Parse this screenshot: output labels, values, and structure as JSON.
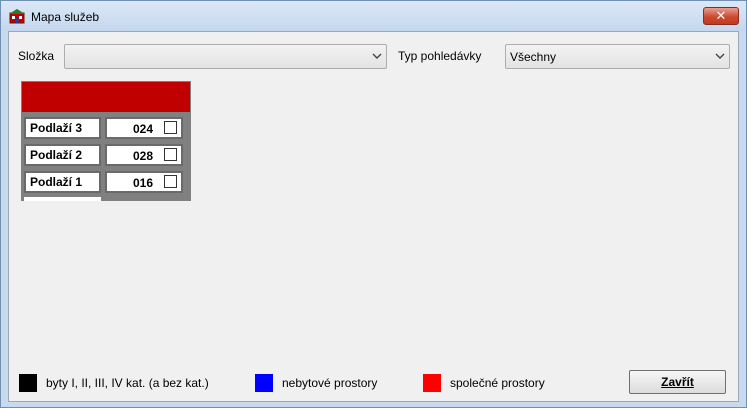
{
  "window": {
    "title": "Mapa služeb",
    "close_label": "✕"
  },
  "filters": {
    "folder_label": "Složka",
    "folder_value": "",
    "type_label": "Typ pohledávky",
    "type_value": "Všechny"
  },
  "map": {
    "header_color": "#c00000",
    "floors": [
      {
        "label": "Podlaží 3",
        "code": "024",
        "checked": false
      },
      {
        "label": "Podlaží 2",
        "code": "028",
        "checked": false
      },
      {
        "label": "Podlaží 1",
        "code": "016",
        "checked": false
      }
    ]
  },
  "legend": [
    {
      "label": "byty I, II, III, IV kat. (a bez kat.)",
      "color": "#000000"
    },
    {
      "label": "nebytové prostory",
      "color": "#0000ff"
    },
    {
      "label": "společné prostory",
      "color": "#ff0000"
    }
  ],
  "buttons": {
    "close_label": "Zavřít"
  }
}
